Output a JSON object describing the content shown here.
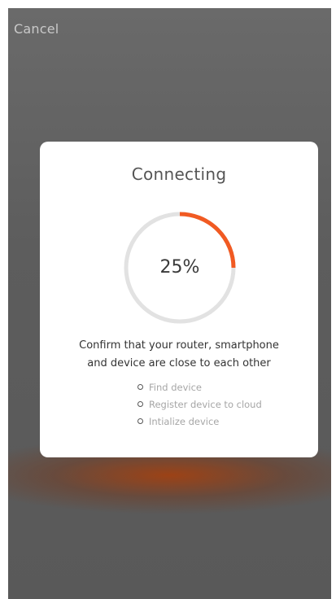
{
  "header": {
    "cancel_label": "Cancel"
  },
  "dialog": {
    "title": "Connecting",
    "progress": {
      "percent": 25,
      "label": "25%"
    },
    "message_line1": "Confirm that your router, smartphone",
    "message_line2": "and device are close to each other",
    "steps": [
      {
        "label": "Find device"
      },
      {
        "label": "Register device to cloud"
      },
      {
        "label": "Intialize device"
      }
    ]
  },
  "colors": {
    "accent": "#f15a22",
    "ring_track": "#e2e2e2",
    "overlay": "#5e5e5e",
    "glow": "#a83e0a"
  }
}
